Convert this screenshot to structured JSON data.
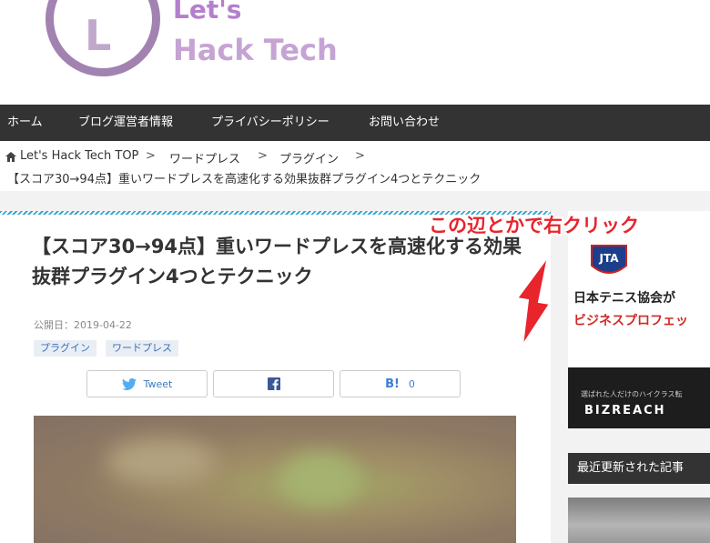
{
  "logo": {
    "letter": "L",
    "line1": "Let's",
    "line2": "Hack Tech"
  },
  "nav": {
    "items": [
      "ホーム",
      "ブログ運営者情報",
      "プライバシーポリシー",
      "お問い合わせ"
    ]
  },
  "breadcrumb": {
    "items": [
      "Let's Hack Tech TOP",
      "ワードプレス",
      "プラグイン"
    ],
    "separator": ">",
    "current": "【スコア30→94点】重いワードプレスを高速化する効果抜群プラグイン4つとテクニック"
  },
  "article": {
    "title": "【スコア30→94点】重いワードプレスを高速化する効果抜群プラグイン4つとテクニック",
    "published": "公開日：2019-04-22",
    "tags": [
      "プラグイン",
      "ワードプレス"
    ],
    "share": {
      "tweet": "Tweet",
      "hatena_count": "0",
      "hatena_label": "B!"
    }
  },
  "ad": {
    "line1": "日本テニス協会が",
    "line2": "ビジネスプロフェッ",
    "small": "選ばれた人だけのハイクラス転",
    "brand": "BIZREACH"
  },
  "sidebar": {
    "recent_heading": "最近更新された記事"
  },
  "annotation": {
    "text": "この辺とかで右クリック",
    "color": "#e8242c"
  },
  "colors": {
    "nav_bg": "#333333",
    "accent": "#3aa6d3",
    "logo_purple": "#a182b0"
  }
}
